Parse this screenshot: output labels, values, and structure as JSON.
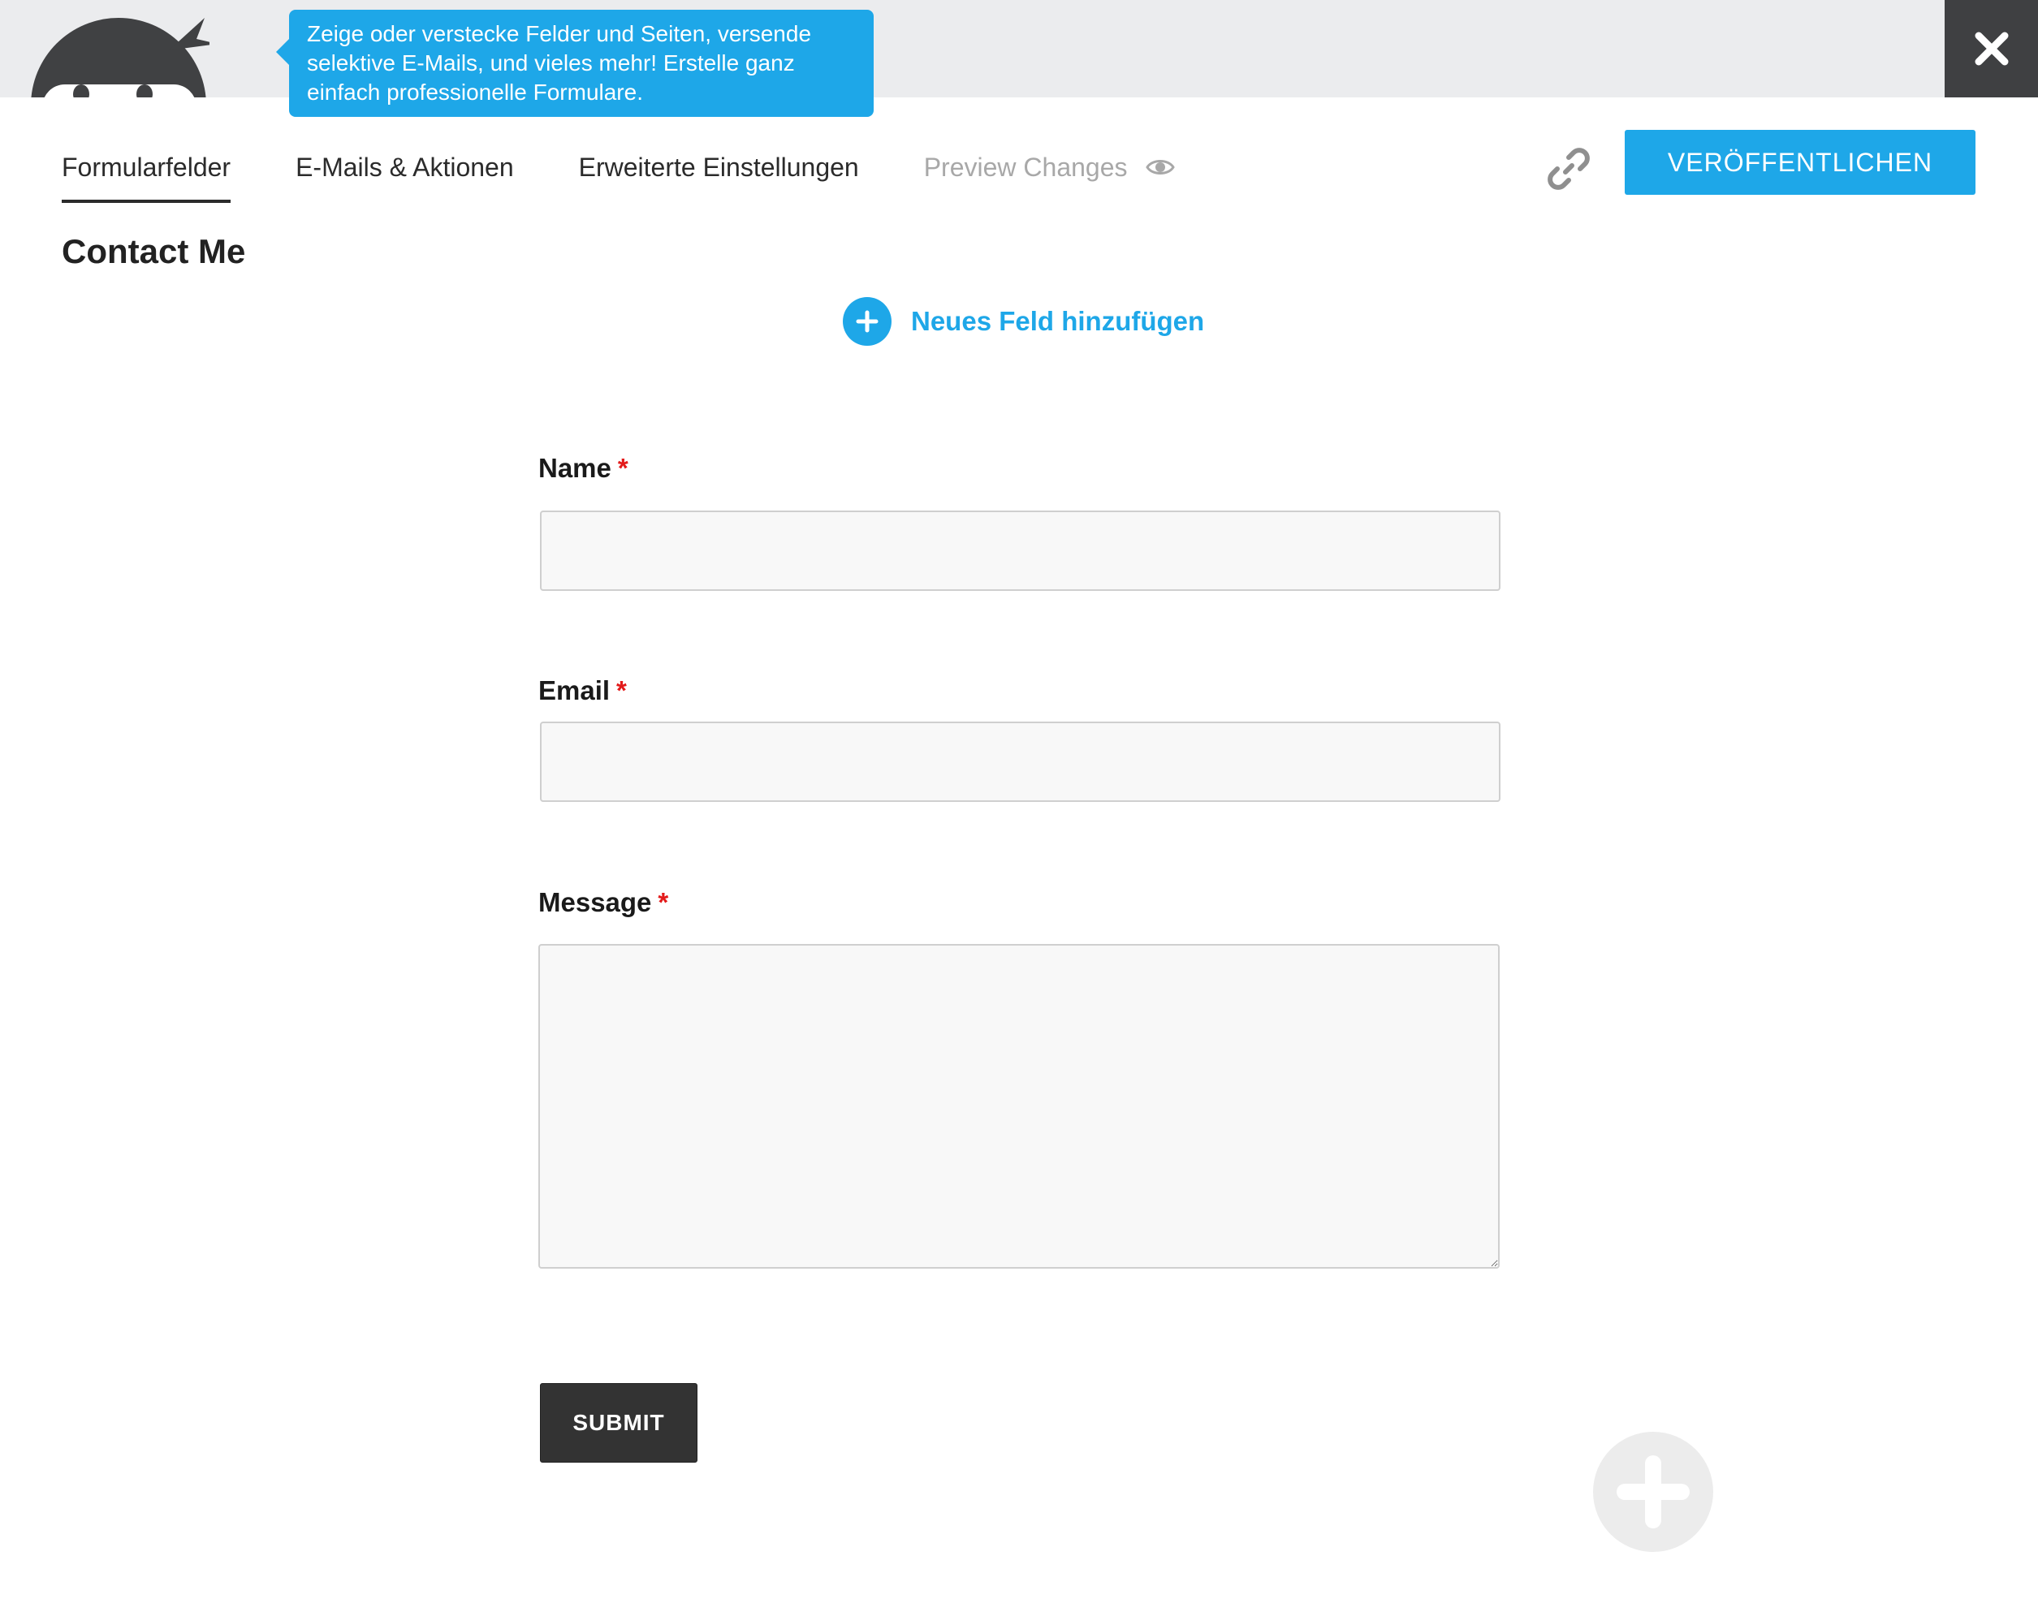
{
  "tooltip": {
    "text": "Zeige oder verstecke Felder und Seiten, versende selektive E-Mails, und vieles mehr! Erstelle ganz einfach professionelle Formulare."
  },
  "tabs": [
    {
      "label": "Formularfelder",
      "active": true
    },
    {
      "label": "E-Mails & Aktionen",
      "active": false
    },
    {
      "label": "Erweiterte Einstellungen",
      "active": false
    },
    {
      "label": "Preview Changes",
      "active": false
    }
  ],
  "header": {
    "publish_label": "VERÖFFENTLICHEN"
  },
  "form": {
    "title": "Contact Me",
    "add_field_label": "Neues Feld hinzufügen",
    "required_marker": "*",
    "fields": [
      {
        "label": "Name",
        "value": "",
        "type": "text"
      },
      {
        "label": "Email",
        "value": "",
        "type": "email"
      },
      {
        "label": "Message",
        "value": "",
        "type": "textarea"
      }
    ],
    "submit_label": "SUBMIT"
  },
  "colors": {
    "accent": "#1ea7e8",
    "topbar": "#ebecee",
    "close_bg": "#3f4042",
    "submit_bg": "#333333",
    "required": "#e31b1b"
  },
  "icons": {
    "mascot": "ninja-mascot-icon",
    "close": "close-icon",
    "preview": "eye-icon",
    "link": "link-icon",
    "add": "plus-icon"
  }
}
